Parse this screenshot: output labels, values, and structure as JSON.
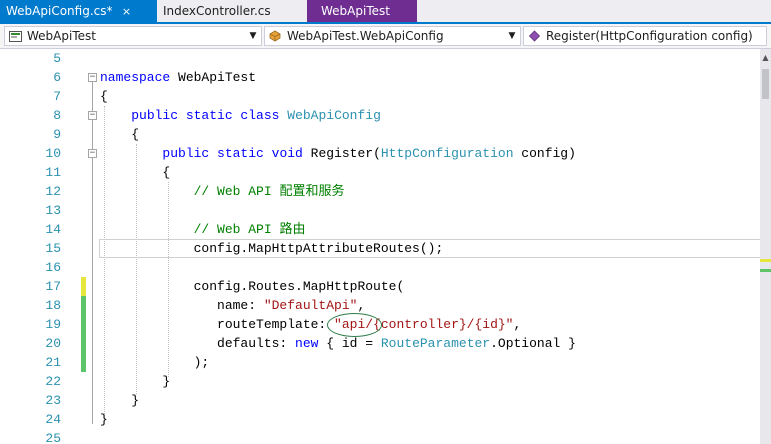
{
  "tabs": [
    {
      "label": "WebApiConfig.cs*",
      "state": "active",
      "close": "×"
    },
    {
      "label": "IndexController.cs",
      "state": "inactive"
    },
    {
      "label": "WebApiTest",
      "state": "preview"
    }
  ],
  "navbar": {
    "project": "WebApiTest",
    "type": "WebApiTest.WebApiConfig",
    "member": "Register(HttpConfiguration config)",
    "dropdown_arrow": "▼"
  },
  "fold_glyph": "−",
  "code_lines": [
    {
      "num": "5",
      "text": ""
    },
    {
      "num": "6",
      "kw1": "namespace",
      "rest": " WebApiTest"
    },
    {
      "num": "7",
      "text": "{"
    },
    {
      "num": "8",
      "indent": "    ",
      "kw1": "public static class",
      "ty": "WebApiConfig"
    },
    {
      "num": "9",
      "text": "    {"
    },
    {
      "num": "10",
      "indent": "        ",
      "kw1": "public static void",
      "rest1": " Register(",
      "ty": "HttpConfiguration",
      "rest2": " config)"
    },
    {
      "num": "11",
      "text": "        {"
    },
    {
      "num": "12",
      "indent": "            ",
      "comment": "// Web API 配置和服务"
    },
    {
      "num": "13",
      "text": ""
    },
    {
      "num": "14",
      "indent": "            ",
      "comment": "// Web API 路由"
    },
    {
      "num": "15",
      "text": "            config.MapHttpAttributeRoutes();"
    },
    {
      "num": "16",
      "text": ""
    },
    {
      "num": "17",
      "text": "            config.Routes.MapHttpRoute("
    },
    {
      "num": "18",
      "pre": "               name: ",
      "str": "\"DefaultApi\"",
      "post": ","
    },
    {
      "num": "19",
      "pre": "               routeTemplate: ",
      "str": "\"api/{controller}/{id}\"",
      "post": ","
    },
    {
      "num": "20",
      "pre": "               defaults: ",
      "kw1": "new",
      "mid": " { id = ",
      "ty": "RouteParameter",
      "post": ".Optional }"
    },
    {
      "num": "21",
      "text": "            );"
    },
    {
      "num": "22",
      "text": "        }"
    },
    {
      "num": "23",
      "text": "    }"
    },
    {
      "num": "24",
      "text": "}"
    },
    {
      "num": "25",
      "text": ""
    }
  ],
  "colors": {
    "keyword": "#0000ff",
    "type": "#2b91af",
    "comment": "#008000",
    "string": "#a31515",
    "accent": "#007acc"
  }
}
